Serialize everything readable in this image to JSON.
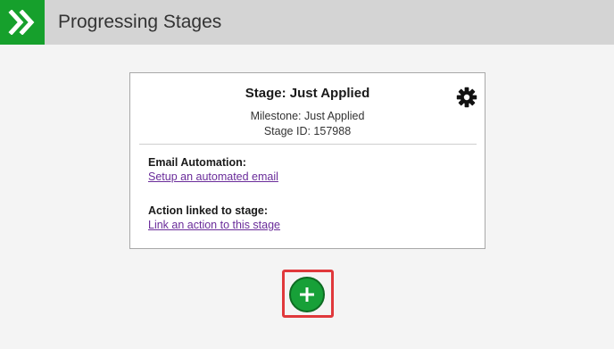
{
  "header": {
    "title": "Progressing Stages",
    "logo_icon": "double-chevron-right-icon",
    "logo_color": "#16a02c"
  },
  "stage_card": {
    "title": "Stage: Just Applied",
    "milestone": "Milestone: Just Applied",
    "stage_id": "Stage ID: 157988",
    "settings_icon": "gear-icon",
    "email_automation": {
      "label": "Email Automation:",
      "link": "Setup an automated email"
    },
    "action_linked": {
      "label": "Action linked to stage:",
      "link": "Link an action to this stage"
    }
  },
  "add_stage": {
    "icon": "plus-icon",
    "color": "#17a038",
    "highlight_color": "#e0383b"
  }
}
